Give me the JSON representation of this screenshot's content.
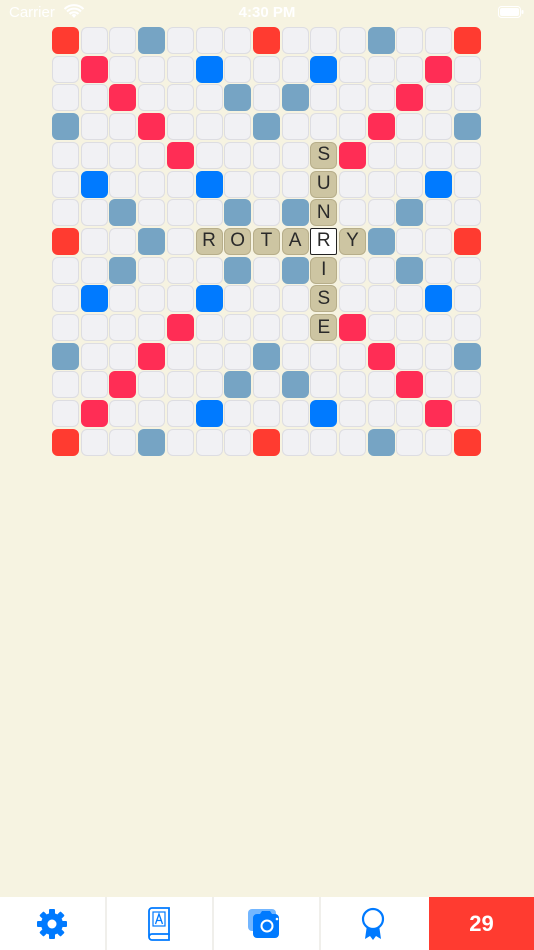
{
  "status_bar": {
    "carrier": "Carrier",
    "time": "4:30 PM"
  },
  "board": {
    "size": 15,
    "visible_rows": 15,
    "premium": {
      "tw": [
        [
          0,
          0
        ],
        [
          0,
          7
        ],
        [
          0,
          14
        ],
        [
          7,
          0
        ],
        [
          7,
          14
        ],
        [
          14,
          0
        ],
        [
          14,
          7
        ],
        [
          14,
          14
        ]
      ],
      "dw": [
        [
          1,
          1
        ],
        [
          1,
          13
        ],
        [
          2,
          2
        ],
        [
          2,
          12
        ],
        [
          3,
          3
        ],
        [
          3,
          11
        ],
        [
          4,
          4
        ],
        [
          4,
          10
        ],
        [
          10,
          4
        ],
        [
          10,
          10
        ],
        [
          11,
          3
        ],
        [
          11,
          11
        ],
        [
          12,
          2
        ],
        [
          12,
          12
        ],
        [
          13,
          1
        ],
        [
          13,
          13
        ]
      ],
      "tl": [
        [
          1,
          5
        ],
        [
          1,
          9
        ],
        [
          5,
          1
        ],
        [
          5,
          5
        ],
        [
          5,
          9
        ],
        [
          5,
          13
        ],
        [
          9,
          1
        ],
        [
          9,
          5
        ],
        [
          9,
          9
        ],
        [
          9,
          13
        ],
        [
          13,
          5
        ],
        [
          13,
          9
        ]
      ],
      "dl": [
        [
          0,
          3
        ],
        [
          0,
          11
        ],
        [
          2,
          6
        ],
        [
          2,
          8
        ],
        [
          3,
          0
        ],
        [
          3,
          7
        ],
        [
          3,
          14
        ],
        [
          6,
          2
        ],
        [
          6,
          6
        ],
        [
          6,
          8
        ],
        [
          6,
          12
        ],
        [
          7,
          3
        ],
        [
          7,
          11
        ],
        [
          8,
          2
        ],
        [
          8,
          6
        ],
        [
          8,
          8
        ],
        [
          8,
          12
        ],
        [
          11,
          0
        ],
        [
          11,
          7
        ],
        [
          11,
          14
        ],
        [
          12,
          6
        ],
        [
          12,
          8
        ],
        [
          14,
          3
        ],
        [
          14,
          11
        ]
      ]
    },
    "tiles": [
      {
        "row": 4,
        "col": 9,
        "letter": "S"
      },
      {
        "row": 5,
        "col": 9,
        "letter": "U"
      },
      {
        "row": 6,
        "col": 9,
        "letter": "N"
      },
      {
        "row": 7,
        "col": 5,
        "letter": "R"
      },
      {
        "row": 7,
        "col": 6,
        "letter": "O"
      },
      {
        "row": 7,
        "col": 7,
        "letter": "T"
      },
      {
        "row": 7,
        "col": 8,
        "letter": "A"
      },
      {
        "row": 7,
        "col": 9,
        "letter": "R",
        "cursor": true
      },
      {
        "row": 7,
        "col": 10,
        "letter": "Y"
      },
      {
        "row": 8,
        "col": 9,
        "letter": "I"
      },
      {
        "row": 9,
        "col": 9,
        "letter": "S"
      },
      {
        "row": 10,
        "col": 9,
        "letter": "E"
      }
    ]
  },
  "tabbar": {
    "tabs": [
      {
        "name": "settings",
        "icon": "gear-icon"
      },
      {
        "name": "dictionary",
        "icon": "book-icon"
      },
      {
        "name": "camera",
        "icon": "camera-icon"
      },
      {
        "name": "achievements",
        "icon": "award-ribbon-icon"
      }
    ],
    "score": "29",
    "icon_color": "#007aff",
    "score_color": "#ff3b30"
  }
}
